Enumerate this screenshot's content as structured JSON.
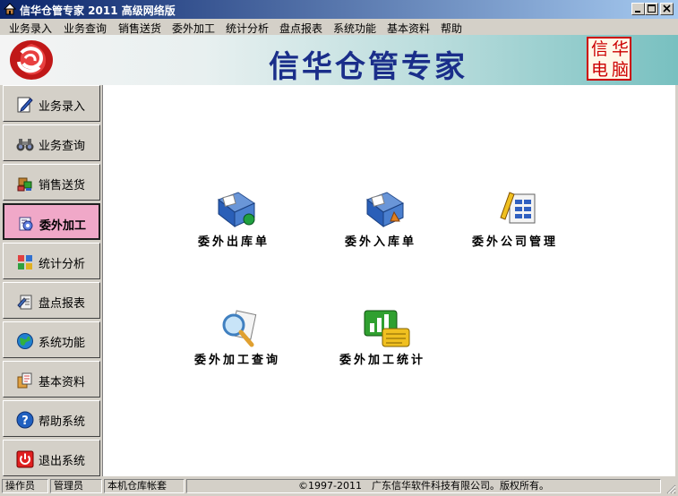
{
  "window": {
    "title": "信华仓管专家 2011 高级网络版"
  },
  "menu": [
    "业务录入",
    "业务查询",
    "销售送货",
    "委外加工",
    "统计分析",
    "盘点报表",
    "系统功能",
    "基本资料",
    "帮助"
  ],
  "banner": {
    "title": "信华仓管专家",
    "stamp": [
      "信",
      "华",
      "电",
      "脑"
    ]
  },
  "sidebar": [
    {
      "label": "业务录入",
      "icon": "pencil-note-icon"
    },
    {
      "label": "业务查询",
      "icon": "binoculars-icon"
    },
    {
      "label": "销售送货",
      "icon": "goods-truck-icon"
    },
    {
      "label": "委外加工",
      "icon": "gear-process-icon",
      "active": true
    },
    {
      "label": "统计分析",
      "icon": "stats-grid-icon"
    },
    {
      "label": "盘点报表",
      "icon": "report-icon"
    },
    {
      "label": "系统功能",
      "icon": "globe-icon"
    },
    {
      "label": "基本资料",
      "icon": "documents-icon"
    },
    {
      "label": "帮助系统",
      "icon": "help-icon"
    },
    {
      "label": "退出系统",
      "icon": "power-icon"
    }
  ],
  "tiles": [
    {
      "label": "委外出库单",
      "icon": "outbound-form-icon"
    },
    {
      "label": "委外入库单",
      "icon": "inbound-form-icon"
    },
    {
      "label": "委外公司管理",
      "icon": "company-manage-icon"
    },
    {
      "label": "委外加工查询",
      "icon": "magnifier-query-icon"
    },
    {
      "label": "委外加工统计",
      "icon": "chart-stats-icon"
    }
  ],
  "status": {
    "operator_label": "操作员",
    "operator": "管理员",
    "account": "本机仓库帐套",
    "copyright": "©1997-2011　广东信华软件科技有限公司。版权所有。"
  },
  "colors": {
    "title_bar": "#0a246a",
    "banner_text": "#1a2e8a",
    "active_button": "#f0a8c8",
    "stamp": "#cc0000"
  }
}
